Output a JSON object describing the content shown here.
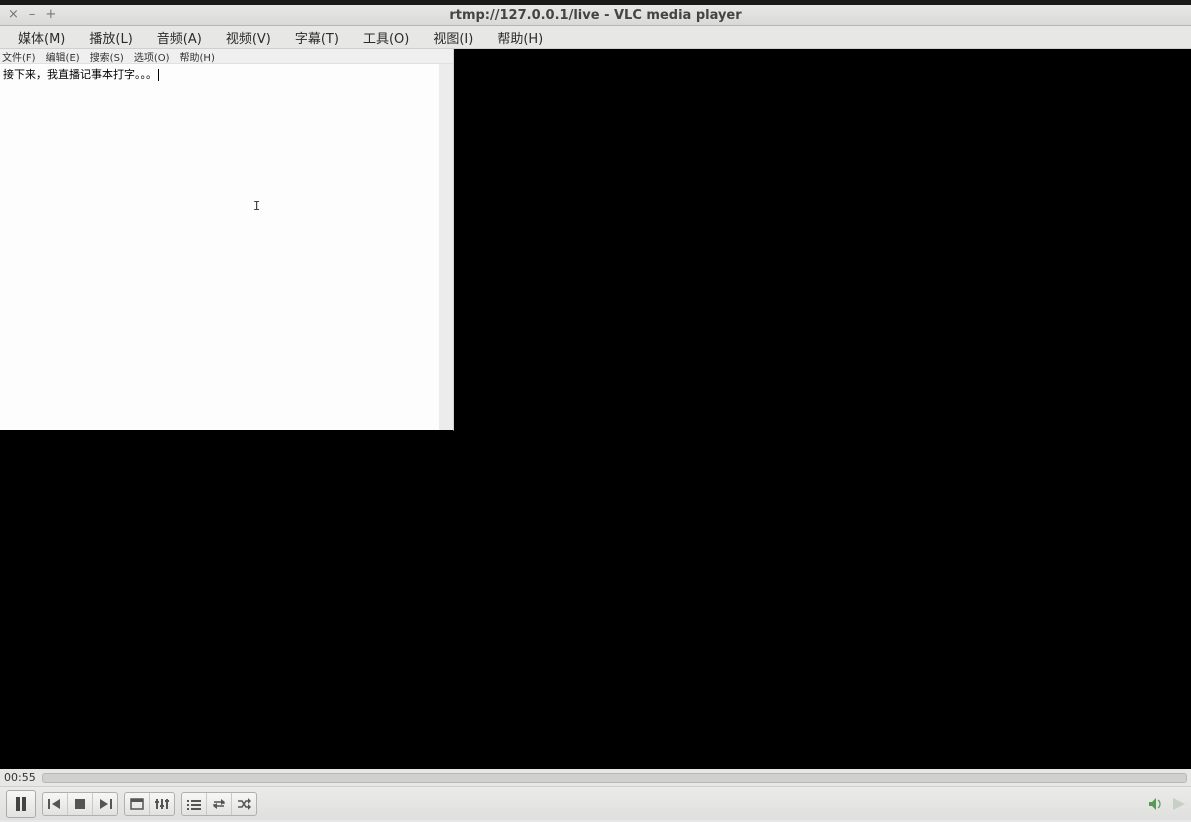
{
  "titlebar": {
    "title": "rtmp://127.0.0.1/live - VLC media player",
    "close": "×",
    "minimize": "–",
    "maximize": "+"
  },
  "vlc_menu": {
    "media": "媒体(M)",
    "playback": "播放(L)",
    "audio": "音频(A)",
    "video": "视频(V)",
    "subtitle": "字幕(T)",
    "tools": "工具(O)",
    "view": "视图(I)",
    "help": "帮助(H)"
  },
  "notepad": {
    "menu": {
      "file": "文件(F)",
      "edit": "编辑(E)",
      "search": "搜索(S)",
      "options": "选项(O)",
      "help": "帮助(H)"
    },
    "text": "接下来，我直播记事本打字。。。"
  },
  "player": {
    "elapsed": "00:55"
  }
}
